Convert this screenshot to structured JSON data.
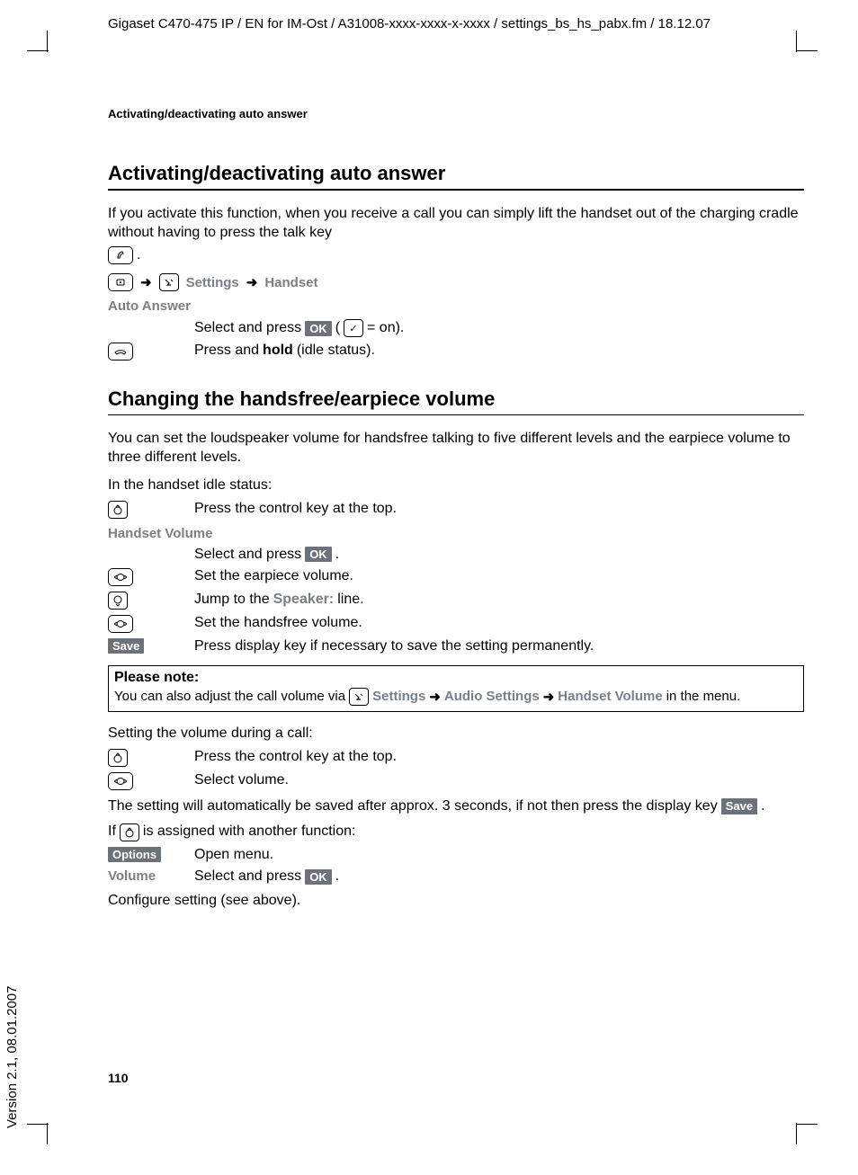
{
  "header": "Gigaset C470-475 IP / EN for IM-Ost / A31008-xxxx-xxxx-x-xxxx / settings_bs_hs_pabx.fm / 18.12.07",
  "running_head": "Activating/deactivating auto answer",
  "section1": {
    "title": "Activating/deactivating auto answer",
    "intro": "If you activate this function, when you receive a call you can simply lift the handset out of the charging cradle without having to press the talk key ",
    "intro_end": ".",
    "nav": {
      "settings": "Settings",
      "handset": "Handset"
    },
    "sub": "Auto Answer",
    "step1a": "Select and press ",
    "step1b": " (",
    "step1c": " = on).",
    "step2a": "Press and ",
    "step2b": "hold",
    "step2c": " (idle status)."
  },
  "section2": {
    "title": "Changing the handsfree/earpiece volume",
    "intro": "You can set the loudspeaker volume for handsfree talking to five different levels and the earpiece volume to three different levels.",
    "idle_line": "In the handset idle status:",
    "step_pressTop": "Press the control key at the top.",
    "sub": "Handset Volume",
    "step_select": "Select and press ",
    "step_select_end": ".",
    "step_earpiece": "Set the earpiece volume.",
    "step_jump_a": "Jump to the ",
    "step_jump_b": "Speaker:",
    "step_jump_c": " line.",
    "step_handsfree": "Set the handsfree volume.",
    "step_save": "Press display key if necessary to save the setting permanently.",
    "note": {
      "title": "Please note:",
      "a": "You can also adjust the call volume via ",
      "settings": "Settings",
      "audio": "Audio Settings",
      "handset_vol": "Handset Volume",
      "b": " in the menu."
    },
    "during_call": "Setting the volume during a call:",
    "during_pressTop": "Press the control key at the top.",
    "during_select": "Select volume.",
    "auto_save_a": "The setting will automatically be saved after approx. 3 seconds, if not then press the display key ",
    "auto_save_b": ".",
    "assigned_a": "If ",
    "assigned_b": " is assigned with another function:",
    "options_label": "Options",
    "open_menu": "Open menu.",
    "volume_label": "Volume",
    "volume_select": "Select and press ",
    "volume_select_end": ".",
    "configure": "Configure setting (see above)."
  },
  "buttons": {
    "ok": "OK",
    "save": "Save"
  },
  "page_number": "110",
  "version": "Version 2.1, 08.01.2007"
}
